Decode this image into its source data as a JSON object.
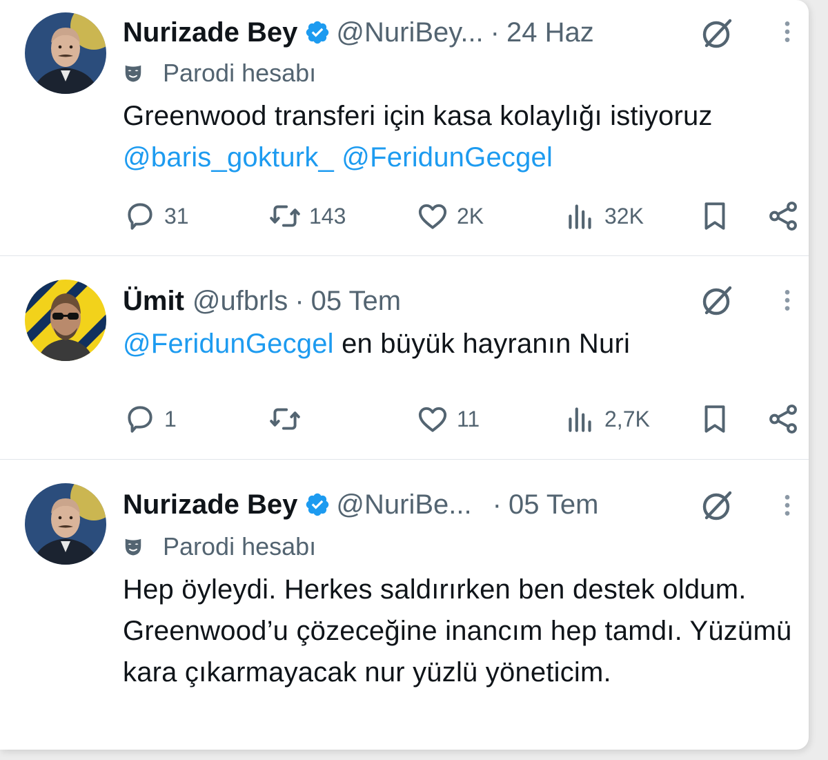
{
  "tweets": [
    {
      "author": "Nurizade Bey",
      "handle": "@NuriBey...",
      "date": "24 Haz",
      "separator": "·",
      "verified": true,
      "label": "Parodi hesabı",
      "text_plain": "Greenwood transferi için kasa kolaylığı istiyoruz ",
      "mention1": "@baris_gokturk_",
      "mention2": "@FeridunGecgel",
      "replies": "31",
      "retweets": "143",
      "likes": "2K",
      "views": "32K"
    },
    {
      "author": "Ümit",
      "handle": "@ufbrls",
      "date": "05 Tem",
      "separator": "·",
      "verified": false,
      "mention1": "@FeridunGecgel",
      "text_plain": " en büyük hayranın Nuri",
      "replies": "1",
      "retweets": "",
      "likes": "11",
      "views": "2,7K"
    },
    {
      "author": "Nurizade Bey",
      "handle": "@NuriBe...",
      "date": "05 Tem",
      "separator": "·",
      "verified": true,
      "label": "Parodi hesabı",
      "text_plain": "Hep öyleydi. Herkes saldırırken ben destek oldum. Greenwood’u çözeceğine inancım hep tamdı. Yüzümü kara çıkarmayacak nur yüzlü yöneticim."
    }
  ],
  "icons": {
    "verified": "verified-badge-icon",
    "grok": "grok-icon",
    "more": "more-options-icon",
    "parody": "parody-mask-icon",
    "reply": "reply-icon",
    "retweet": "retweet-icon",
    "like": "like-icon",
    "views": "views-icon",
    "bookmark": "bookmark-icon",
    "share": "share-icon"
  },
  "colors": {
    "text": "#0f1419",
    "secondary": "#536471",
    "link": "#1d9bf0",
    "verified": "#1d9bf0"
  }
}
